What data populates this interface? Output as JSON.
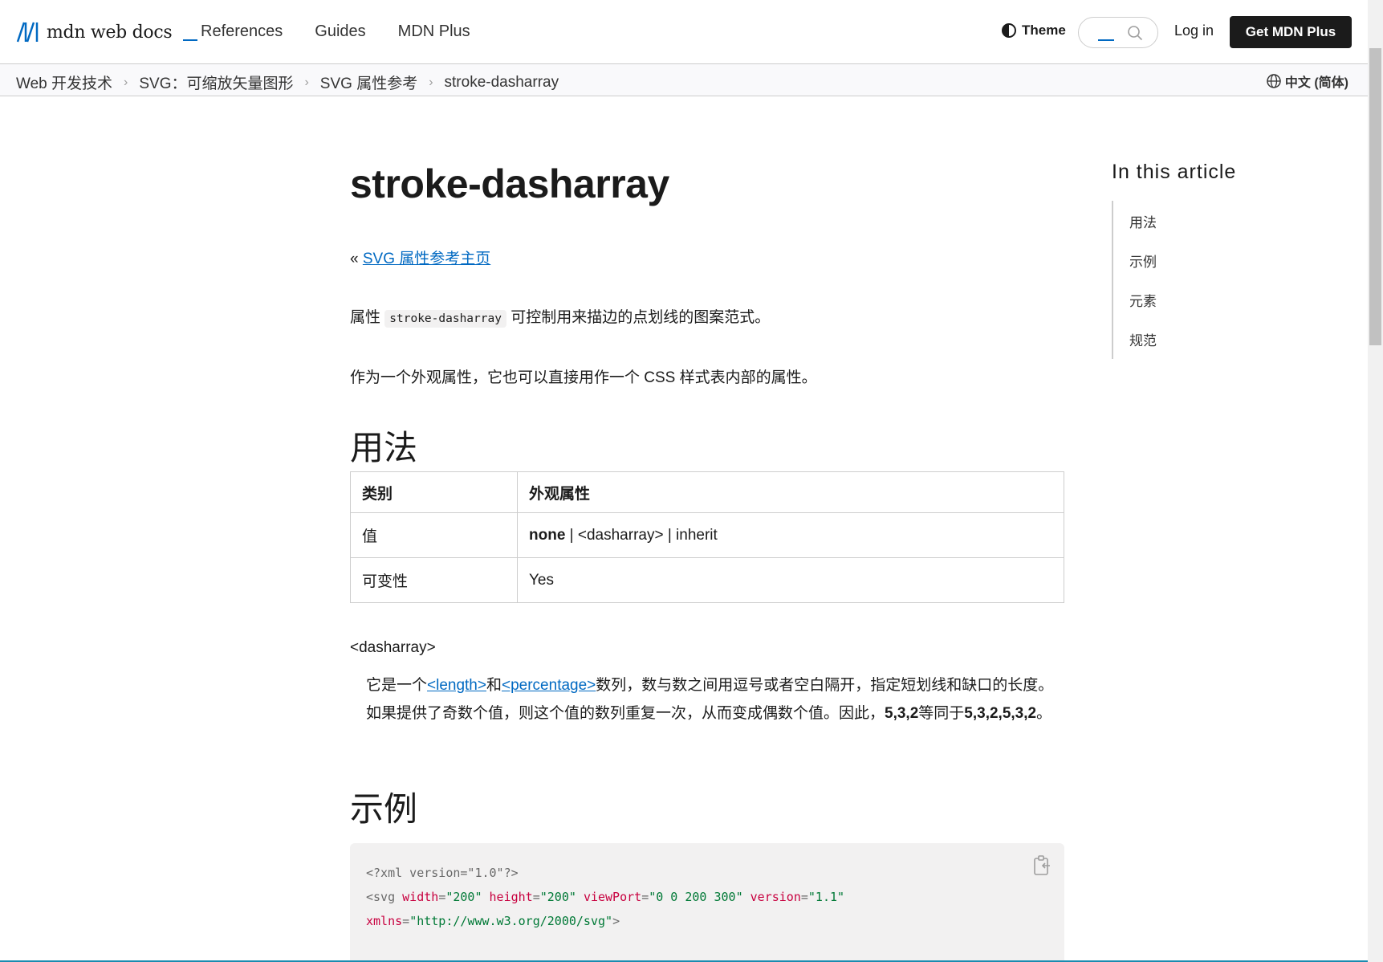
{
  "header": {
    "logo_text": "mdn web docs",
    "nav": [
      "References",
      "Guides",
      "MDN Plus"
    ],
    "theme_label": "Theme",
    "login_label": "Log in",
    "cta_label": "Get MDN Plus"
  },
  "breadcrumb": [
    "Web 开发技术",
    "SVG：可缩放矢量图形",
    "SVG 属性参考",
    "stroke-dasharray"
  ],
  "language": "中文 (简体)",
  "article": {
    "title": "stroke-dasharray",
    "back_prefix": "« ",
    "back_link": "SVG 属性参考主页",
    "intro_pre": "属性 ",
    "intro_code": "stroke-dasharray",
    "intro_post": " 可控制用来描边的点划线的图案范式。",
    "para2": "作为一个外观属性，它也可以直接用作一个 CSS 样式表内部的属性。",
    "h2_usage": "用法",
    "table": {
      "header": [
        "类别",
        "外观属性"
      ],
      "rows": [
        {
          "label": "值",
          "value_bold": "none",
          "value_rest": " | <dasharray> | inherit"
        },
        {
          "label": "可变性",
          "value_bold": "",
          "value_rest": "Yes"
        }
      ]
    },
    "dt": "<dasharray>",
    "dd": {
      "pre": "它是一个",
      "link1": "<length>",
      "mid": "和",
      "link2": "<percentage>",
      "post": "数列，数与数之间用逗号或者空白隔开，指定短划线和缺口的长度。如果提供了奇数个值，则这个值的数列重复一次，从而变成偶数个值。因此，",
      "b1": "5,3,2",
      "post2": "等同于",
      "b2": "5,3,2,5,3,2",
      "end": "。"
    },
    "h2_example": "示例",
    "code": {
      "line1": "<?xml version=\"1.0\"?>",
      "l2_tag": "<svg",
      "l2_attrs": [
        {
          "name": "width",
          "value": "\"200\""
        },
        {
          "name": "height",
          "value": "\"200\""
        },
        {
          "name": "viewPort",
          "value": "\"0 0 200 300\""
        },
        {
          "name": "version",
          "value": "\"1.1\""
        }
      ],
      "l3_attr": "xmlns",
      "l3_value": "\"http://www.w3.org/2000/svg\"",
      "l3_close": ">"
    }
  },
  "toc": {
    "title": "In this article",
    "items": [
      "用法",
      "示例",
      "元素",
      "规范"
    ]
  },
  "colors": {
    "link": "#0069c2",
    "cta_bg": "#1b1b1b",
    "code_attr": "#c8003f",
    "code_string": "#007936"
  },
  "icons": [
    "mdn-logo-icon",
    "theme-icon",
    "search-icon",
    "chevron-right-icon",
    "globe-icon",
    "copy-icon"
  ]
}
